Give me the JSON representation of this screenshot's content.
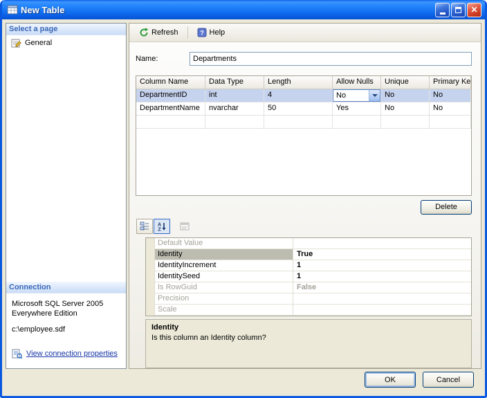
{
  "window": {
    "title": "New Table"
  },
  "sidebar": {
    "select_page_header": "Select a page",
    "general_page": "General",
    "connection_header": "Connection",
    "server_line1": "Microsoft SQL Server 2005",
    "server_line2": "Everywhere Edition",
    "database_path": "c:\\employee.sdf",
    "connection_link": "View connection properties"
  },
  "toolbar": {
    "refresh_label": "Refresh",
    "help_label": "Help"
  },
  "form": {
    "name_label": "Name:",
    "name_value": "Departments"
  },
  "columns_grid": {
    "headers": [
      "Column Name",
      "Data Type",
      "Length",
      "Allow Nulls",
      "Unique",
      "Primary Key"
    ],
    "rows": [
      {
        "column_name": "DepartmentID",
        "data_type": "int",
        "length": "4",
        "allow_nulls": "No",
        "unique": "No",
        "primary_key": "No"
      },
      {
        "column_name": "DepartmentName",
        "data_type": "nvarchar",
        "length": "50",
        "allow_nulls": "Yes",
        "unique": "No",
        "primary_key": "No"
      }
    ],
    "delete_label": "Delete"
  },
  "property_grid": {
    "rows": [
      {
        "name": "Default Value",
        "value": ""
      },
      {
        "name": "Identity",
        "value": "True"
      },
      {
        "name": "IdentityIncrement",
        "value": "1"
      },
      {
        "name": "IdentitySeed",
        "value": "1"
      },
      {
        "name": "Is RowGuid",
        "value": "False"
      },
      {
        "name": "Precision",
        "value": ""
      },
      {
        "name": "Scale",
        "value": ""
      }
    ],
    "description_title": "Identity",
    "description_text": "Is this column an Identity column?"
  },
  "footer": {
    "ok_label": "OK",
    "cancel_label": "Cancel"
  },
  "icons": {
    "close_glyph": "✕"
  }
}
